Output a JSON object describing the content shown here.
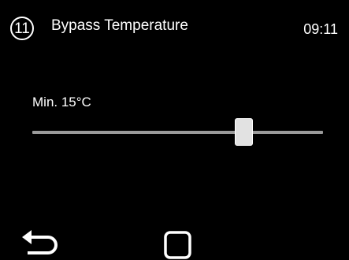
{
  "header": {
    "step_number": "11",
    "title": "Bypass Temperature",
    "time": "09:11"
  },
  "setting": {
    "label": "Min. 15°C",
    "slider_fraction": 0.73
  },
  "footer": {
    "back_icon": "back-arrow-icon",
    "home_icon": "square-home-icon"
  },
  "colors": {
    "background": "#000000",
    "text": "#ffffff",
    "track": "#9a9a9a",
    "thumb": "#e2e2e2"
  }
}
